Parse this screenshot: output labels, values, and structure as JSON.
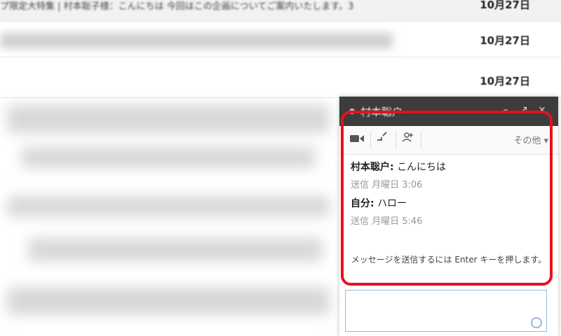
{
  "inbox": {
    "rows": [
      {
        "subject": "プ限定大特集 | 村本聡子様：こんにちは 今回はこの企画についてご案内いたします。3",
        "date": "10月27日"
      },
      {
        "subject": "",
        "date": "10月27日"
      },
      {
        "subject": "",
        "date": "10月27日"
      }
    ]
  },
  "chat": {
    "title": "村本聡户",
    "controls": {
      "minimize": "–",
      "popout": "↗",
      "close": "×"
    },
    "toolbar": {
      "more_label": "その他 ▾"
    },
    "messages": [
      {
        "sender": "村本聡户:",
        "text": "こんにちは",
        "meta": "送信 月曜日 3:06"
      },
      {
        "sender": "自分:",
        "text": "ハロー",
        "meta": "送信 月曜日 5:46"
      }
    ],
    "hint": "メッセージを送信するには Enter キーを押します。",
    "input_placeholder": ""
  },
  "colors": {
    "highlight": "#e8101a",
    "titlebar": "#3c3c3c",
    "input_border": "#9ab6e0"
  }
}
